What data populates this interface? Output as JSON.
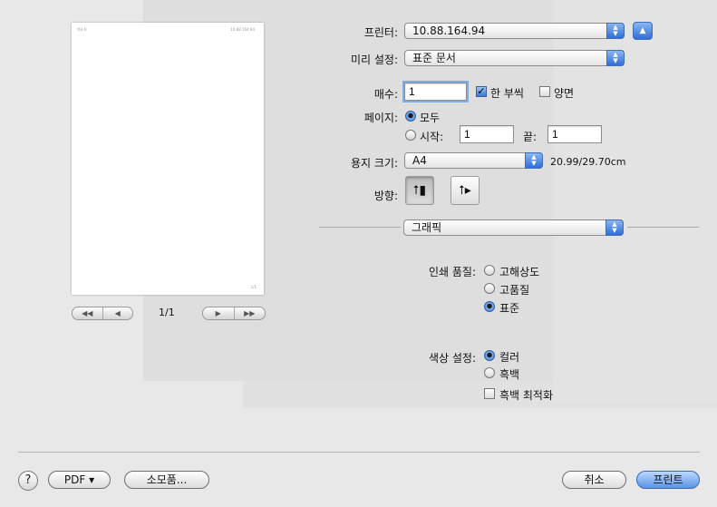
{
  "preview": {
    "page_counter": "1/1",
    "thumb_header_left": "텍스트",
    "thumb_header_right": "10.88.164.94",
    "thumb_footer": "1/1"
  },
  "printer": {
    "label": "프린터:",
    "value": "10.88.164.94"
  },
  "presets": {
    "label": "미리 설정:",
    "value": "표준 문서"
  },
  "copies": {
    "label": "매수:",
    "value": "1",
    "collated_label": "한 부씩",
    "collated_checked": true,
    "duplex_label": "양면",
    "duplex_checked": false
  },
  "pages": {
    "label": "페이지:",
    "all_label": "모두",
    "from_label": "시작:",
    "from_value": "1",
    "to_label": "끝:",
    "to_value": "1",
    "selected": "all"
  },
  "paper": {
    "label": "용지 크기:",
    "value": "A4",
    "dimensions": "20.99/29.70cm"
  },
  "orientation": {
    "label": "방향:",
    "selected": "portrait"
  },
  "section": {
    "value": "그래픽"
  },
  "quality": {
    "label": "인쇄 품질:",
    "options": [
      "고해상도",
      "고품질",
      "표준"
    ],
    "selected": "표준"
  },
  "color": {
    "label": "색상 설정:",
    "options": [
      "컬러",
      "흑백"
    ],
    "selected": "컬러",
    "optimize_label": "흑백 최적화",
    "optimize_checked": false
  },
  "footer": {
    "help": "?",
    "pdf_label": "PDF ▾",
    "supplies_label": "소모품...",
    "cancel_label": "취소",
    "print_label": "프린트"
  }
}
